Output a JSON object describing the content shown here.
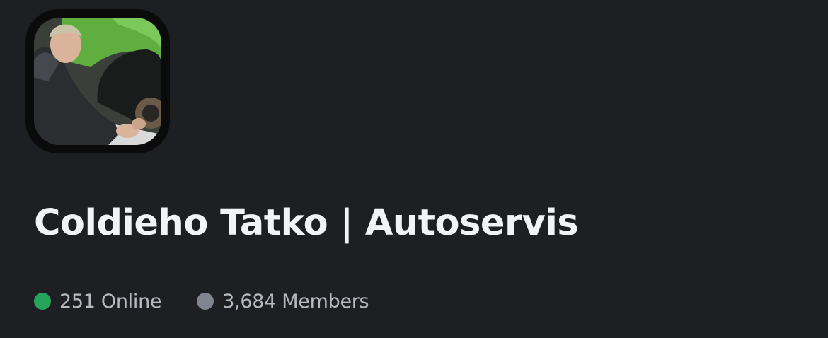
{
  "server": {
    "name": "Coldieho Tatko | Autoservis",
    "avatar_icon": "server-avatar-photo"
  },
  "stats": {
    "online_label": "251 Online",
    "members_label": "3,684 Members"
  },
  "colors": {
    "background": "#1e1f22",
    "title_text": "#f2f3f5",
    "stat_text": "#b5bac1",
    "online_dot": "#23a55a",
    "members_dot": "#80848e"
  }
}
